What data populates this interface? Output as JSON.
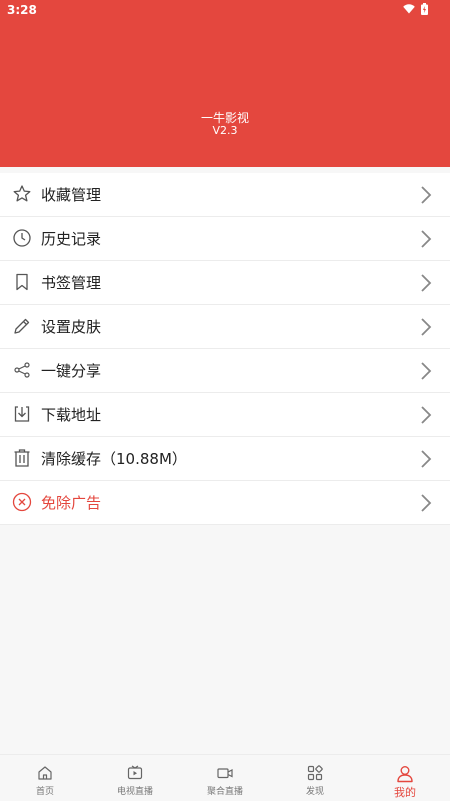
{
  "status_bar": {
    "time": "3:28"
  },
  "header": {
    "app_name": "一牛影视",
    "version": "V2.3"
  },
  "menu": [
    {
      "label": "收藏管理",
      "icon": "star-icon"
    },
    {
      "label": "历史记录",
      "icon": "clock-icon"
    },
    {
      "label": "书签管理",
      "icon": "bookmark-icon"
    },
    {
      "label": "设置皮肤",
      "icon": "pencil-icon"
    },
    {
      "label": "一键分享",
      "icon": "share-icon"
    },
    {
      "label": "下载地址",
      "icon": "download-icon"
    },
    {
      "label": "清除缓存（10.88M）",
      "icon": "trash-icon"
    },
    {
      "label": "免除广告",
      "icon": "close-circle-icon"
    }
  ],
  "tabs": [
    {
      "label": "首页",
      "icon": "home-icon"
    },
    {
      "label": "电视直播",
      "icon": "tv-icon"
    },
    {
      "label": "聚合直播",
      "icon": "video-camera-icon"
    },
    {
      "label": "发现",
      "icon": "grid-icon"
    },
    {
      "label": "我的",
      "icon": "user-icon",
      "active": true
    }
  ],
  "colors": {
    "accent": "#e4473e"
  }
}
